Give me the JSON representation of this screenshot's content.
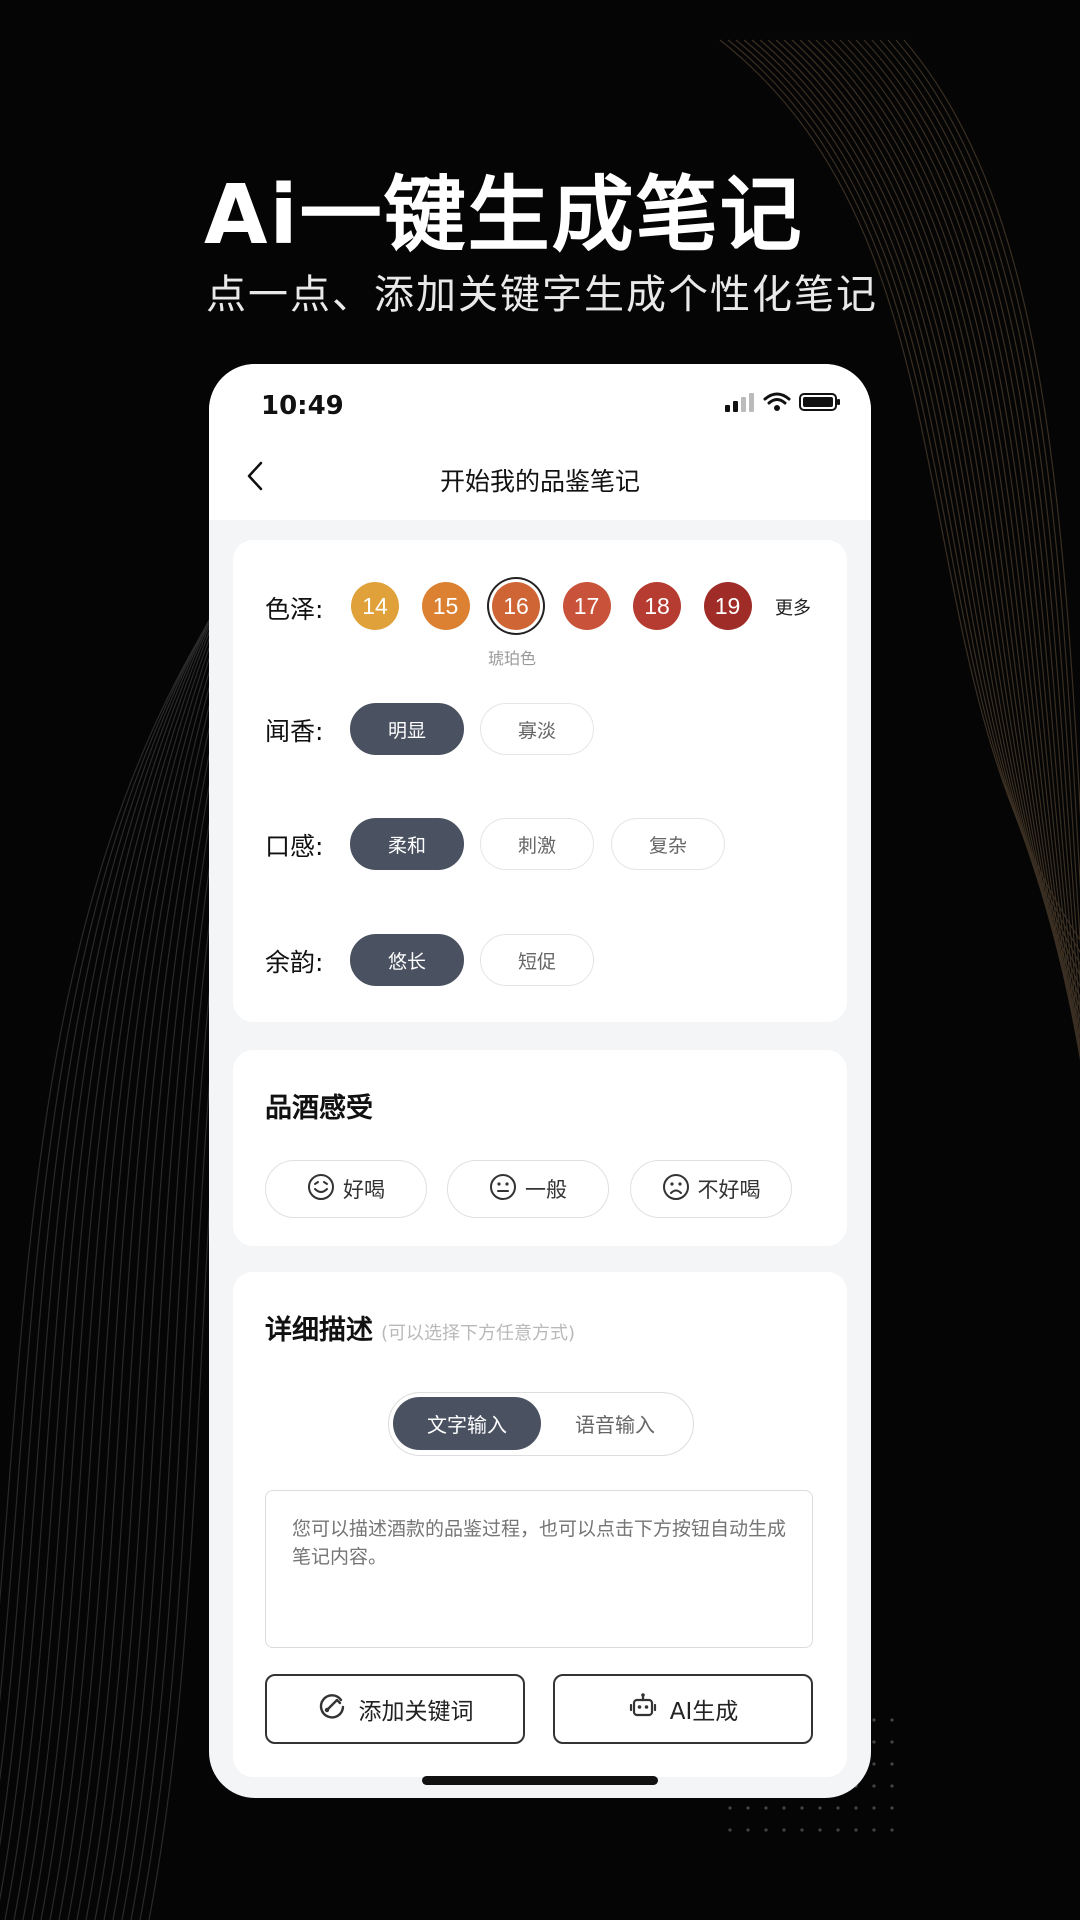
{
  "hero": {
    "title": "Ai一键生成笔记",
    "subtitle": "点一点、添加关键字生成个性化笔记"
  },
  "status_bar": {
    "time": "10:49",
    "icons": [
      "signal-icon",
      "wifi-icon",
      "battery-icon"
    ]
  },
  "nav": {
    "back_icon": "chevron-left-icon",
    "title": "开始我的品鉴笔记"
  },
  "color_row": {
    "label": "色泽:",
    "swatches": [
      {
        "value": "14",
        "color": "#e0a13a"
      },
      {
        "value": "15",
        "color": "#dc8132"
      },
      {
        "value": "16",
        "color": "#cf6534"
      },
      {
        "value": "17",
        "color": "#c9533a"
      },
      {
        "value": "18",
        "color": "#b63b30"
      },
      {
        "value": "19",
        "color": "#9f2c27"
      }
    ],
    "selected_index": 2,
    "selected_caption": "琥珀色",
    "more": "更多"
  },
  "aroma_row": {
    "label": "闻香:",
    "options": [
      "明显",
      "寡淡"
    ],
    "active": "明显"
  },
  "taste_row": {
    "label": "口感:",
    "options": [
      "柔和",
      "刺激",
      "复杂"
    ],
    "active": "柔和"
  },
  "finish_row": {
    "label": "余韵:",
    "options": [
      "悠长",
      "短促"
    ],
    "active": "悠长"
  },
  "feeling": {
    "title": "品酒感受",
    "options": [
      {
        "label": "好喝",
        "icon": "smile-face-icon"
      },
      {
        "label": "一般",
        "icon": "neutral-face-icon"
      },
      {
        "label": "不好喝",
        "icon": "sad-face-icon"
      }
    ]
  },
  "description": {
    "title": "详细描述",
    "hint": "(可以选择下方任意方式)",
    "modes": [
      "文字输入",
      "语音输入"
    ],
    "active_mode": "文字输入",
    "placeholder": "您可以描述酒款的品鉴过程，也可以点击下方按钮自动生成笔记内容。",
    "buttons": {
      "add_keyword": "添加关键词",
      "add_keyword_icon": "add-keyword-icon",
      "ai_generate": "AI生成",
      "ai_generate_icon": "robot-icon"
    }
  },
  "colors": {
    "background": "#050505",
    "chip_active": "#4a5160",
    "accent_line": "#8a6a3a"
  }
}
